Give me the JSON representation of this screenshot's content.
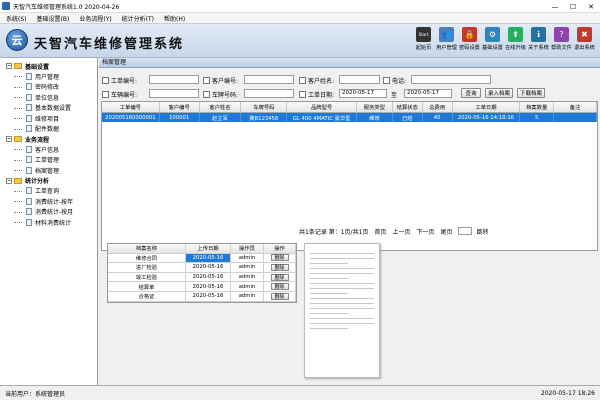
{
  "window": {
    "title": "天智汽车维修管理系统1.0 2020-04-26",
    "min": "—",
    "max": "☐",
    "close": "✕"
  },
  "menu": [
    "系统(S)",
    "基础设置(B)",
    "业务流程(Y)",
    "统计分析(T)",
    "帮助(H)"
  ],
  "banner": {
    "logo_char": "云",
    "title": "天智汽车维修管理系统"
  },
  "toolbar": [
    {
      "label": "起始页",
      "icon": "start-icon",
      "glyph": "Start",
      "color": "#333333"
    },
    {
      "label": "用户管理",
      "icon": "user-icon",
      "glyph": "👥",
      "color": "#4a7fc1"
    },
    {
      "label": "密码设置",
      "icon": "lock-icon",
      "glyph": "🔒",
      "color": "#c0392b"
    },
    {
      "label": "基础设置",
      "icon": "gear-icon",
      "glyph": "⚙",
      "color": "#2e86c1"
    },
    {
      "label": "在线升级",
      "icon": "upgrade-icon",
      "glyph": "⬆",
      "color": "#27ae60"
    },
    {
      "label": "关于系统",
      "icon": "info-icon",
      "glyph": "ℹ",
      "color": "#2471a3"
    },
    {
      "label": "帮助文件",
      "icon": "help-icon",
      "glyph": "?",
      "color": "#8e44ad"
    },
    {
      "label": "退出系统",
      "icon": "exit-icon",
      "glyph": "✖",
      "color": "#c0392b"
    }
  ],
  "sidebar": [
    {
      "group": "基础设置",
      "items": [
        "用户管理",
        "密码修改",
        "单位信息",
        "基本数据设置",
        "维修项目",
        "配件数据"
      ]
    },
    {
      "group": "业务流程",
      "items": [
        "客户信息",
        "工单管理",
        "档案管理"
      ]
    },
    {
      "group": "统计分析",
      "items": [
        "工单查询",
        "消费统计-按年",
        "消费统计-按月",
        "材料消费统计"
      ]
    }
  ],
  "panel": {
    "title": "档案管理"
  },
  "search": {
    "row1": [
      "工单编号:",
      "客户编号:",
      "客户姓名:",
      "电话:"
    ],
    "row2": [
      "车辆编号:",
      "车牌号码:",
      "工单日期:"
    ],
    "date_from": "2020-05-17",
    "date_to_label": "至",
    "date_to": "2020-05-17",
    "btn_query": "查询",
    "btn_add": "录入档案",
    "btn_download": "下载档案"
  },
  "grid": {
    "headers": [
      "工单编号",
      "客户编号",
      "客户姓名",
      "车牌号码",
      "品牌型号",
      "服务类型",
      "结算状态",
      "总费用",
      "工单日期",
      "档案数量",
      "备注"
    ],
    "rows": [
      [
        "202005160000001",
        "100001",
        "赵立军",
        "冀B123456",
        "GL 400 4MATIC 豪华型",
        "维修",
        "已结",
        "40",
        "2020-05-16 14:18:16",
        "5",
        ""
      ]
    ]
  },
  "pager": {
    "info": "共1条记录 第：1页/共1页",
    "first": "首页",
    "prev": "上一页",
    "next": "下一页",
    "last": "尾页",
    "go": "跳转"
  },
  "files": {
    "headers": [
      "档案名称",
      "上传日期",
      "操作员",
      "操作"
    ],
    "rows": [
      [
        "维修合同",
        "2020-05-16",
        "admin",
        "删除"
      ],
      [
        "进厂检验",
        "2020-05-16",
        "admin",
        "删除"
      ],
      [
        "竣工检验",
        "2020-05-16",
        "admin",
        "删除"
      ],
      [
        "结算单",
        "2020-05-16",
        "admin",
        "删除"
      ],
      [
        "合格证",
        "2020-05-16",
        "admin",
        "删除"
      ]
    ]
  },
  "status": {
    "user": "当前用户：系统管理员",
    "datetime": "2020-05-17 18:26"
  }
}
